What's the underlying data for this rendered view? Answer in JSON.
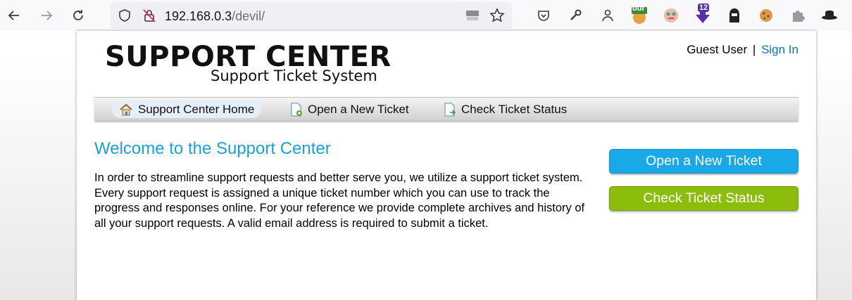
{
  "browser": {
    "url_host": "192.168.0.3",
    "url_path": "/devil/",
    "extensions": {
      "burp_badge": "bur",
      "hackbar_count": "12"
    }
  },
  "site": {
    "logo_title": "SUPPORT CENTER",
    "logo_subtitle": "Support Ticket System",
    "user_label": "Guest User",
    "separator": "|",
    "sign_in": "Sign In"
  },
  "nav": {
    "items": [
      {
        "label": "Support Center Home",
        "icon": "home-icon",
        "active": true
      },
      {
        "label": "Open a New Ticket",
        "icon": "new-ticket-icon"
      },
      {
        "label": "Check Ticket Status",
        "icon": "ticket-status-icon"
      }
    ]
  },
  "main": {
    "heading": "Welcome to the Support Center",
    "intro": "In order to streamline support requests and better serve you, we utilize a support ticket system. Every support request is assigned a unique ticket number which you can use to track the progress and responses online. For your reference we provide complete archives and history of all your support requests. A valid email address is required to submit a ticket."
  },
  "sidebar": {
    "open_ticket_button": "Open a New Ticket",
    "check_status_button": "Check Ticket Status"
  },
  "colors": {
    "heading": "#1ba1d9",
    "link": "#0b72c7",
    "open_button": "#1aa9e8",
    "status_button": "#8dbd0c"
  }
}
